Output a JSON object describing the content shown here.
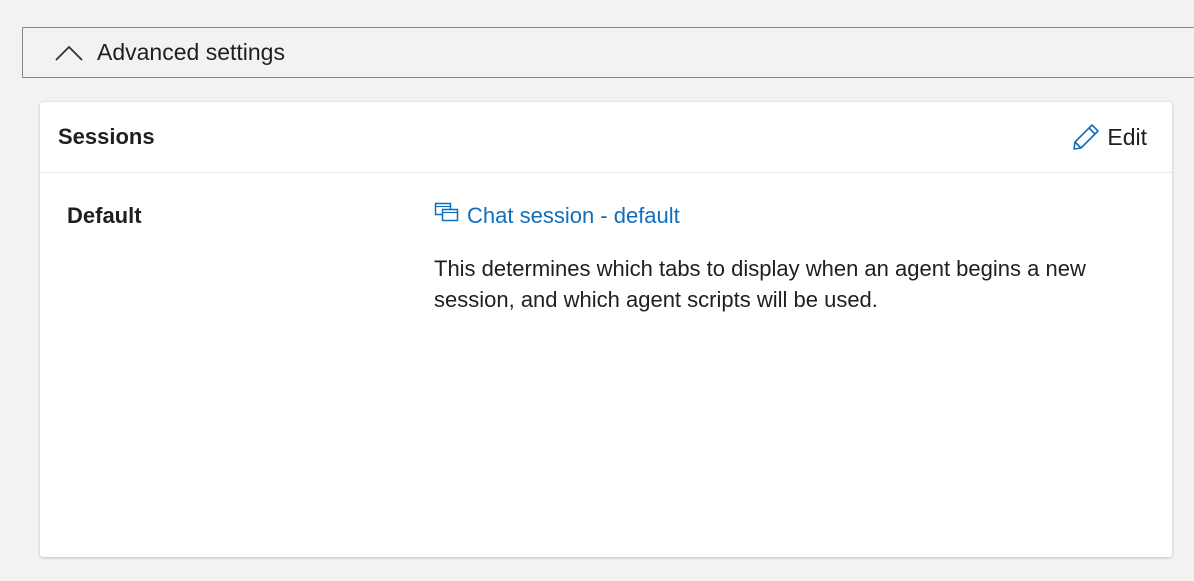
{
  "advanced": {
    "label": "Advanced settings",
    "icon": "chevron-up-icon"
  },
  "sessions_card": {
    "title": "Sessions",
    "edit_label": "Edit",
    "edit_icon": "pencil-icon",
    "rows": [
      {
        "label": "Default",
        "link_icon": "chat-session-icon",
        "link_text": "Chat session - default",
        "description": "This determines which tabs to display when an agent begins a new session, and which agent scripts will be used."
      }
    ]
  },
  "colors": {
    "link": "#106ebe",
    "text": "#201f1e",
    "background": "#f3f2f1"
  }
}
